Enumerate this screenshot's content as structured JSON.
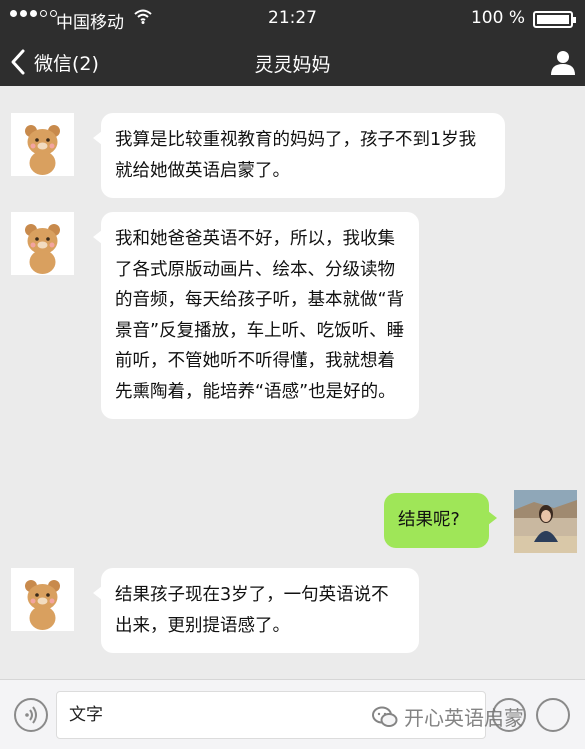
{
  "status_bar": {
    "carrier": "中国移动",
    "time": "21:27",
    "battery_percent": "100 %"
  },
  "nav": {
    "back_label": "微信(2)",
    "title": "灵灵妈妈"
  },
  "messages": [
    {
      "side": "left",
      "sender_icon": "bear-avatar",
      "text": "我算是比较重视教育的妈妈了，孩子不到1岁我就给她做英语启蒙了。"
    },
    {
      "side": "left",
      "sender_icon": "bear-avatar",
      "text": "我和她爸爸英语不好，所以，我收集了各式原版动画片、绘本、分级读物的音频，每天给孩子听，基本就做“背景音”反复播放，车上听、吃饭听、睡前听，不管她听不听得懂，我就想着先熏陶着，能培养“语感”也是好的。"
    },
    {
      "side": "right",
      "sender_icon": "photo-avatar",
      "text": "结果呢?"
    },
    {
      "side": "left",
      "sender_icon": "bear-avatar",
      "text": "结果孩子现在3岁了，一句英语说不出来，更别提语感了。"
    }
  ],
  "input": {
    "placeholder": "文字",
    "watermark": "开心英语启蒙"
  },
  "colors": {
    "header_bg": "#2e2e2e",
    "chat_bg": "#ebebeb",
    "self_bubble": "#9fe658",
    "other_bubble": "#ffffff"
  }
}
